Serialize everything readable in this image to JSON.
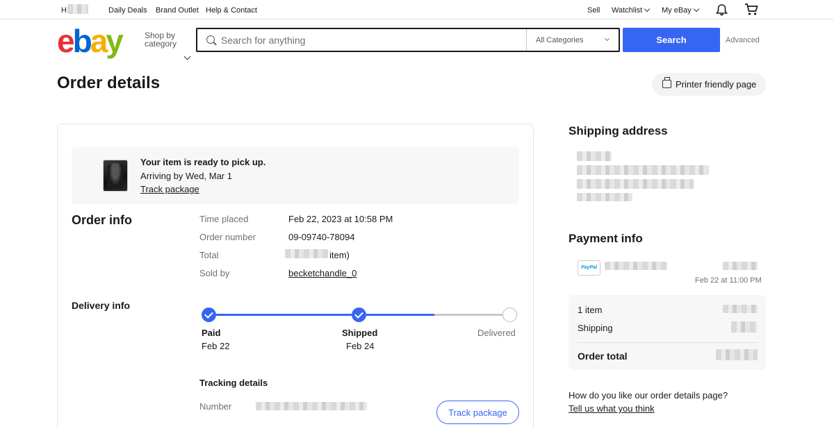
{
  "topbar": {
    "greeting": "H",
    "links": [
      "Daily Deals",
      "Brand Outlet",
      "Help & Contact"
    ],
    "sell": "Sell",
    "watchlist": "Watchlist",
    "myebay": "My eBay",
    "icons": [
      "bell-icon",
      "cart-icon"
    ]
  },
  "header": {
    "logo_letters": [
      "e",
      "b",
      "a",
      "y"
    ],
    "shop_by_line1": "Shop by",
    "shop_by_line2": "category",
    "search_placeholder": "Search for anything",
    "category_selected": "All Categories",
    "search_button": "Search",
    "advanced": "Advanced"
  },
  "page": {
    "title": "Order details",
    "print_button": "Printer friendly page"
  },
  "notice": {
    "headline": "Your item is ready to pick up.",
    "arriving": "Arriving by Wed, Mar 1",
    "track_link": "Track package"
  },
  "order_info": {
    "heading": "Order info",
    "rows": [
      {
        "label": "Time placed",
        "value": "Feb 22, 2023 at 10:58 PM"
      },
      {
        "label": "Order number",
        "value": "09-09740-78094"
      },
      {
        "label": "Total",
        "value": "item)"
      },
      {
        "label": "Sold by",
        "value": "becketchandle_0"
      }
    ]
  },
  "delivery_info": {
    "heading": "Delivery info",
    "steps": [
      {
        "label": "Paid",
        "date": "Feb 22",
        "status": "done"
      },
      {
        "label": "Shipped",
        "date": "Feb 24",
        "status": "done"
      },
      {
        "label": "Delivered",
        "date": "",
        "status": "pending"
      }
    ],
    "progress_color": "#3665f3"
  },
  "tracking": {
    "heading": "Tracking details",
    "number_label": "Number",
    "track_button": "Track package"
  },
  "shipping_address": {
    "heading": "Shipping address"
  },
  "payment_info": {
    "heading": "Payment info",
    "method_logo": "PayPal",
    "timestamp": "Feb 22 at 11:00 PM",
    "summary": {
      "items_label": "1 item",
      "shipping_label": "Shipping",
      "total_label": "Order total"
    }
  },
  "feedback": {
    "question": "How do you like our order details page?",
    "link": "Tell us what you think"
  },
  "colors": {
    "accent": "#3665f3",
    "text": "#191919",
    "muted": "#707070"
  }
}
